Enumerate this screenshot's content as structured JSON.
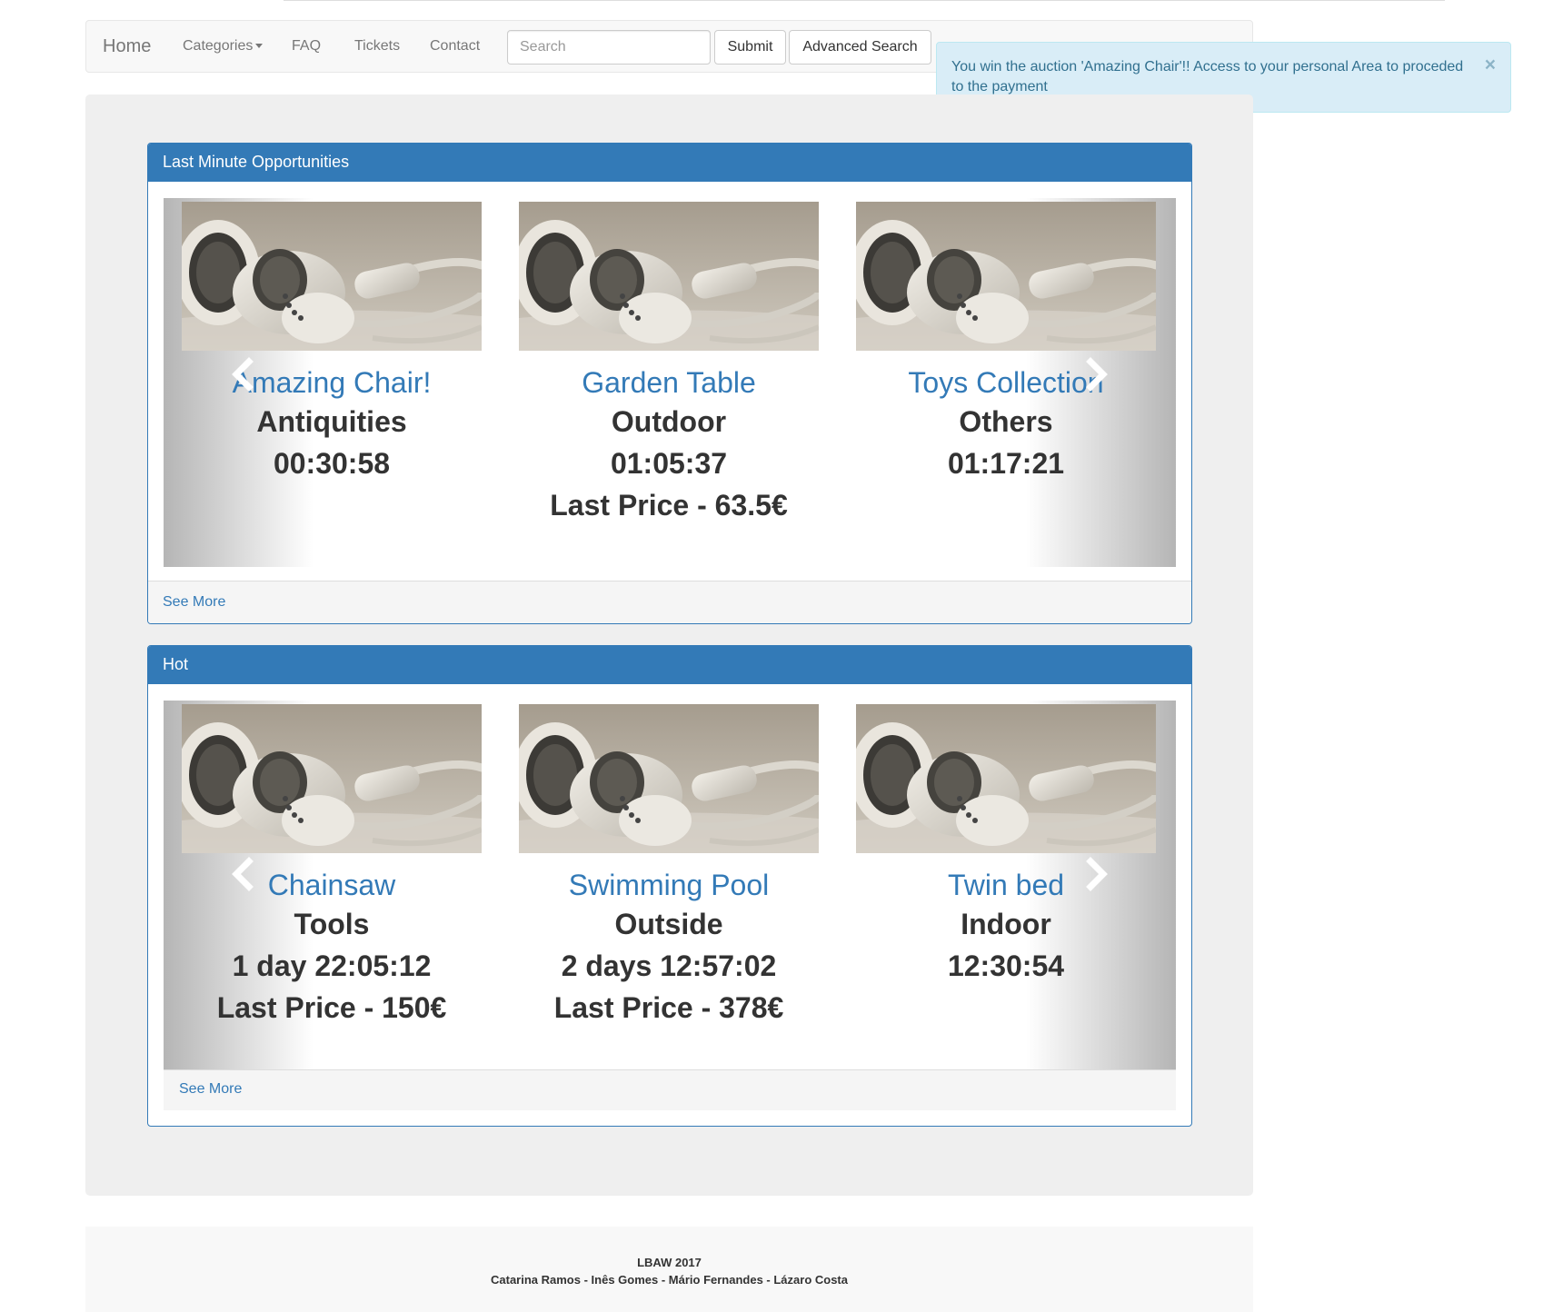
{
  "navbar": {
    "brand": "Home",
    "links": [
      {
        "label": "Categories"
      },
      {
        "label": "FAQ"
      },
      {
        "label": "Tickets"
      },
      {
        "label": "Contact"
      }
    ],
    "search_placeholder": "Search",
    "submit_label": "Submit",
    "advanced_search_label": "Advanced Search"
  },
  "alert": {
    "message": "You win the auction 'Amazing Chair'!! Access to your personal Area to proceded to the payment",
    "close_label": "×"
  },
  "sections": [
    {
      "title": "Last Minute Opportunities",
      "see_more": "See More",
      "items": [
        {
          "title": "Amazing Chair!",
          "category": "Antiquities",
          "time_left": "00:30:58",
          "last_price": ""
        },
        {
          "title": "Garden Table",
          "category": "Outdoor",
          "time_left": "01:05:37",
          "last_price": "Last Price - 63.5€"
        },
        {
          "title": "Toys Collection",
          "category": "Others",
          "time_left": "01:17:21",
          "last_price": ""
        }
      ]
    },
    {
      "title": "Hot",
      "see_more": "See More",
      "items": [
        {
          "title": "Chainsaw",
          "category": "Tools",
          "time_left": "1 day 22:05:12",
          "last_price": "Last Price - 150€"
        },
        {
          "title": "Swimming Pool",
          "category": "Outside",
          "time_left": "2 days 12:57:02",
          "last_price": "Last Price - 378€"
        },
        {
          "title": "Twin bed",
          "category": "Indoor",
          "time_left": "12:30:54",
          "last_price": ""
        }
      ]
    }
  ],
  "footer": {
    "line1": "LBAW 2017",
    "line2": "Catarina Ramos - Inês Gomes - Mário Fernandes - Lázaro Costa"
  },
  "colors": {
    "primary": "#337ab7",
    "alert_bg": "#d9edf7",
    "alert_text": "#31708f"
  },
  "icons": [
    "caret-down-icon",
    "close-icon",
    "chevron-left-icon",
    "chevron-right-icon",
    "earphones-image"
  ]
}
